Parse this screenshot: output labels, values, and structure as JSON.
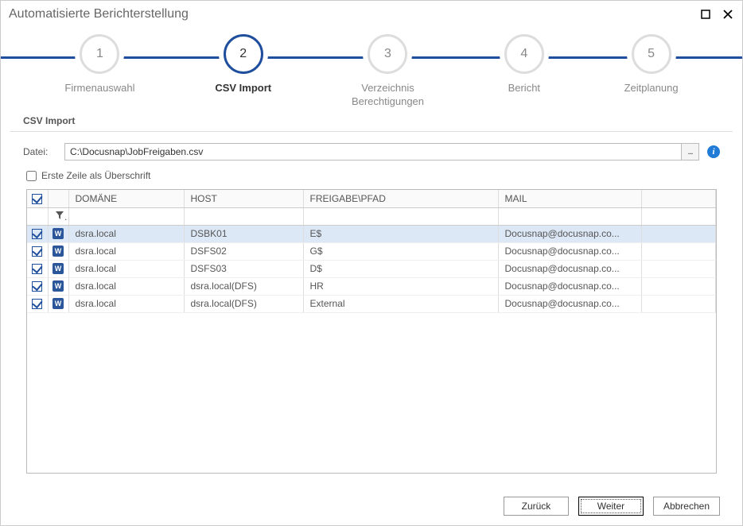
{
  "window": {
    "title": "Automatisierte Berichterstellung"
  },
  "wizard": {
    "steps": [
      {
        "num": "1",
        "label": "Firmenauswahl"
      },
      {
        "num": "2",
        "label": "CSV Import"
      },
      {
        "num": "3",
        "label": "Verzeichnis\nBerechtigungen"
      },
      {
        "num": "4",
        "label": "Bericht"
      },
      {
        "num": "5",
        "label": "Zeitplanung"
      }
    ],
    "active_index": 1
  },
  "section": {
    "title": "CSV Import"
  },
  "file": {
    "label": "Datei:",
    "path": "C:\\Docusnap\\JobFreigaben.csv",
    "browse": "..."
  },
  "options": {
    "first_row_header_label": "Erste Zeile als Überschrift",
    "first_row_header_checked": false
  },
  "table": {
    "columns": {
      "domain": "DOMÄNE",
      "host": "HOST",
      "share": "FREIGABE\\PFAD",
      "mail": "MAIL"
    },
    "rows": [
      {
        "checked": true,
        "domain": "dsra.local",
        "host": "DSBK01",
        "share": "E$",
        "mail": "Docusnap@docusnap.co..."
      },
      {
        "checked": true,
        "domain": "dsra.local",
        "host": "DSFS02",
        "share": "G$",
        "mail": "Docusnap@docusnap.co..."
      },
      {
        "checked": true,
        "domain": "dsra.local",
        "host": "DSFS03",
        "share": "D$",
        "mail": "Docusnap@docusnap.co..."
      },
      {
        "checked": true,
        "domain": "dsra.local",
        "host": "dsra.local(DFS)",
        "share": "HR",
        "mail": "Docusnap@docusnap.co..."
      },
      {
        "checked": true,
        "domain": "dsra.local",
        "host": "dsra.local(DFS)",
        "share": "External",
        "mail": "Docusnap@docusnap.co..."
      }
    ]
  },
  "buttons": {
    "back": "Zurück",
    "next": "Weiter",
    "cancel": "Abbrechen"
  }
}
